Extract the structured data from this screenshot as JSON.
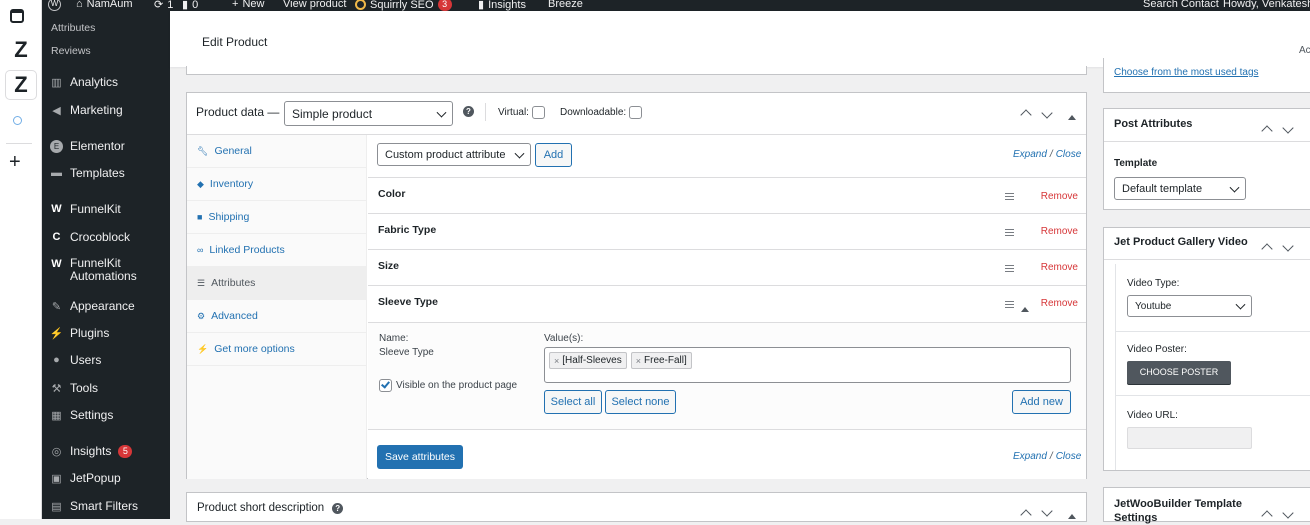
{
  "adminbar": {
    "site_name": "NamAum",
    "updates_count": "1",
    "comments_count": "0",
    "new_label": "New",
    "view_product": "View product",
    "squirrly_label": "Squirrly SEO",
    "squirrly_badge": "3",
    "insights_label": "Insights",
    "breeze_label": "Breeze",
    "search_contact": "Search Contact",
    "howdy": "Howdy, Venkatesh"
  },
  "strip": {
    "z1": "Z",
    "z2": "Z"
  },
  "sidebar": {
    "submenu": [
      "Attributes",
      "Reviews"
    ],
    "items": [
      {
        "label": "Analytics",
        "icon": "bar-chart-icon"
      },
      {
        "label": "Marketing",
        "icon": "megaphone-icon"
      },
      {
        "label": "Elementor",
        "icon": "elementor-icon"
      },
      {
        "label": "Templates",
        "icon": "folder-icon"
      },
      {
        "label": "FunnelKit",
        "icon": "funnelkit-icon"
      },
      {
        "label": "Crocoblock",
        "icon": "crocoblock-icon"
      },
      {
        "label": "FunnelKit Automations",
        "icon": "funnelkit-icon"
      },
      {
        "label": "Appearance",
        "icon": "brush-icon"
      },
      {
        "label": "Plugins",
        "icon": "plug-icon"
      },
      {
        "label": "Users",
        "icon": "user-icon"
      },
      {
        "label": "Tools",
        "icon": "wrench-icon"
      },
      {
        "label": "Settings",
        "icon": "sliders-icon"
      },
      {
        "label": "Insights",
        "icon": "insights-icon",
        "badge": "5"
      },
      {
        "label": "JetPopup",
        "icon": "jetpopup-icon"
      },
      {
        "label": "Smart Filters",
        "icon": "filter-icon"
      }
    ]
  },
  "header": {
    "title": "Edit Product",
    "right_cut": "Ac"
  },
  "product_data": {
    "title": "Product data —",
    "type_selected": "Simple product",
    "virtual_label": "Virtual:",
    "downloadable_label": "Downloadable:",
    "tabs": [
      {
        "label": "General",
        "icon": "wrench-icon"
      },
      {
        "label": "Inventory",
        "icon": "tag-icon"
      },
      {
        "label": "Shipping",
        "icon": "truck-icon"
      },
      {
        "label": "Linked Products",
        "icon": "link-icon"
      },
      {
        "label": "Attributes",
        "icon": "list-icon",
        "active": true
      },
      {
        "label": "Advanced",
        "icon": "gear-icon"
      },
      {
        "label": "Get more options",
        "icon": "plugin-icon"
      }
    ],
    "custom_attr_select": "Custom product attribute",
    "add_label": "Add",
    "expand": "Expand",
    "slash": "/",
    "close": "Close",
    "attributes": [
      {
        "name": "Color",
        "remove": "Remove"
      },
      {
        "name": "Fabric Type",
        "remove": "Remove"
      },
      {
        "name": "Size",
        "remove": "Remove"
      },
      {
        "name": "Sleeve Type",
        "remove": "Remove"
      }
    ],
    "expanded": {
      "name_label": "Name:",
      "name_value": "Sleeve Type",
      "values_label": "Value(s):",
      "values": [
        "[Half-Sleeves",
        "Free-Fall]"
      ],
      "visible_label": "Visible on the product page",
      "select_all": "Select all",
      "select_none": "Select none",
      "add_new": "Add new"
    },
    "save_attributes": "Save attributes"
  },
  "short_description": {
    "title": "Product short description"
  },
  "right": {
    "tags_link": "Choose from the most used tags",
    "post_attributes": {
      "title": "Post Attributes",
      "template_label": "Template",
      "template_value": "Default template"
    },
    "gallery_video": {
      "title": "Jet Product Gallery Video",
      "video_type_label": "Video Type:",
      "video_type_value": "Youtube",
      "video_poster_label": "Video Poster:",
      "choose_poster": "CHOOSE POSTER",
      "video_url_label": "Video URL:"
    },
    "jetwoo": {
      "title_line1": "JetWooBuilder Template",
      "title_line2": "Settings"
    }
  },
  "colors": {
    "accent": "#2271b1",
    "danger": "#d63638",
    "sidebar": "#1d2327"
  }
}
